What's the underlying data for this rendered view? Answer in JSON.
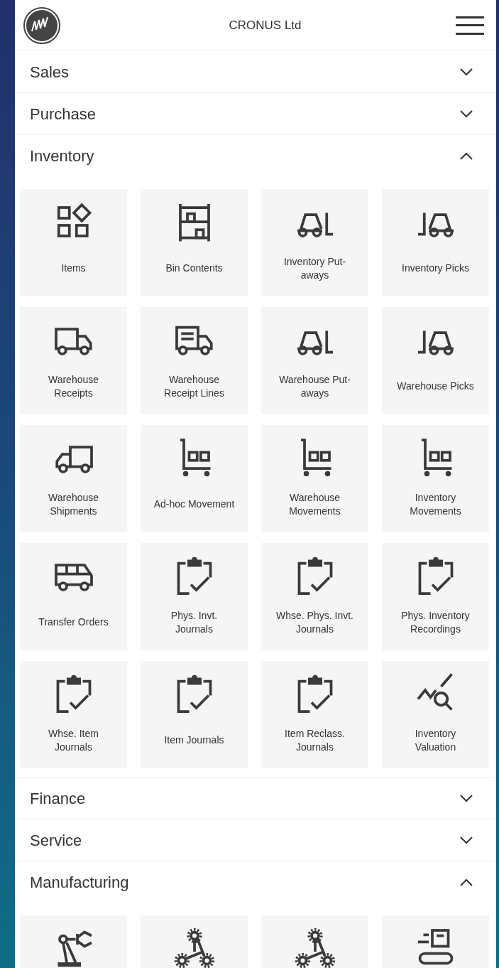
{
  "header": {
    "title": "CRONUS Ltd"
  },
  "sections": [
    {
      "title": "Sales",
      "expanded": false
    },
    {
      "title": "Purchase",
      "expanded": false
    },
    {
      "title": "Inventory",
      "expanded": true,
      "tiles": [
        {
          "kind": "grid",
          "label": "Items"
        },
        {
          "kind": "shelf",
          "label": "Bin Contents"
        },
        {
          "kind": "fork-r",
          "label": "Inventory Put-aways"
        },
        {
          "kind": "fork-l",
          "label": "Inventory Picks"
        },
        {
          "kind": "truck",
          "label": "Warehouse Receipts"
        },
        {
          "kind": "truck-lines",
          "label": "Warehouse Receipt Lines"
        },
        {
          "kind": "fork-r",
          "label": "Warehouse Put-aways"
        },
        {
          "kind": "fork-l",
          "label": "Warehouse Picks"
        },
        {
          "kind": "truck-l",
          "label": "Warehouse Shipments"
        },
        {
          "kind": "cart",
          "label": "Ad-hoc Movement"
        },
        {
          "kind": "cart",
          "label": "Warehouse Movements"
        },
        {
          "kind": "cart",
          "label": "Inventory Movements"
        },
        {
          "kind": "van",
          "label": "Transfer Orders"
        },
        {
          "kind": "clip",
          "label": "Phys. Invt. Journals"
        },
        {
          "kind": "clip",
          "label": "Whse. Phys. Invt. Journals"
        },
        {
          "kind": "clip",
          "label": "Phys. Inventory Recordings"
        },
        {
          "kind": "clip",
          "label": "Whse. Item Journals"
        },
        {
          "kind": "clip",
          "label": "Item Journals"
        },
        {
          "kind": "clip",
          "label": "Item Reclass. Journals"
        },
        {
          "kind": "chart",
          "label": "Inventory Valuation"
        }
      ]
    },
    {
      "title": "Finance",
      "expanded": false
    },
    {
      "title": "Service",
      "expanded": false
    },
    {
      "title": "Manufacturing",
      "expanded": true,
      "tiles": [
        {
          "kind": "robot"
        },
        {
          "kind": "gears"
        },
        {
          "kind": "gears"
        },
        {
          "kind": "conveyor"
        }
      ]
    }
  ]
}
